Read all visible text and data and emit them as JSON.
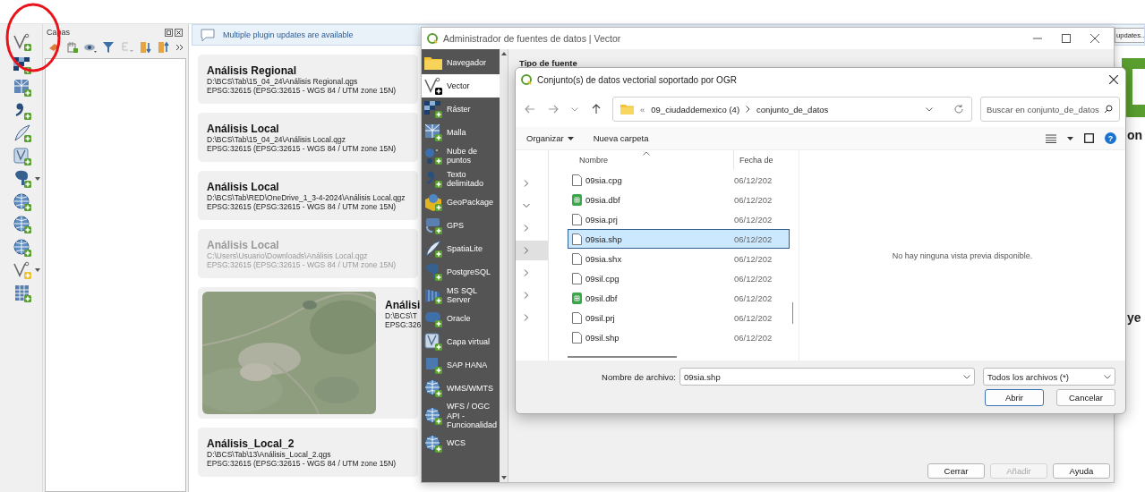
{
  "layers_panel": {
    "title": "Capas"
  },
  "message_bar": {
    "text": "Multiple plugin updates are available",
    "button": "updates..."
  },
  "recent_projects": [
    {
      "kind": "text",
      "title": "Análisis Regional",
      "path": "D:\\BCS\\Tab\\15_04_24\\Análisis Regional.qgs",
      "crs": "EPSG:32615 (EPSG:32615 - WGS 84 / UTM zone 15N)",
      "disabled": false
    },
    {
      "kind": "text",
      "title": "Análisis Local",
      "path": "D:\\BCS\\Tab\\15_04_24\\Análisis Local.qgz",
      "crs": "EPSG:32615 (EPSG:32615 - WGS 84 / UTM zone 15N)",
      "disabled": false
    },
    {
      "kind": "text",
      "title": "Análisis Local",
      "path": "D:\\BCS\\Tab\\RED\\OneDrive_1_3-4-2024\\Análisis Local.qgz",
      "crs": "EPSG:32615 (EPSG:32615 - WGS 84 / UTM zone 15N)",
      "disabled": false
    },
    {
      "kind": "text",
      "title": "Análisis Local",
      "path": "C:\\Users\\Usuario\\Downloads\\Análisis Local.qgz",
      "crs": "EPSG:32615 (EPSG:32615 - WGS 84 / UTM zone 15N)",
      "disabled": true
    },
    {
      "kind": "picture",
      "title": "Análisi",
      "path": "D:\\BCS\\T",
      "crs": "EPSG:326",
      "disabled": false
    },
    {
      "kind": "text",
      "title": "Análisis_Local_2",
      "path": "D:\\BCS\\Tab\\13\\Análisis_Local_2.qgs",
      "crs": "EPSG:32615 (EPSG:32615 - WGS 84 / UTM zone 15N)",
      "disabled": false
    }
  ],
  "right_column": {
    "heading_fragment": "on",
    "section_fragment": "ye"
  },
  "source_manager": {
    "title": "Administrador de fuentes de datos | Vector",
    "section_heading": "Tipo de fuente",
    "sidebar": [
      {
        "label": "Navegador",
        "selected": false
      },
      {
        "label": "Vector",
        "selected": true
      },
      {
        "label": "Ráster",
        "selected": false
      },
      {
        "label": "Malla",
        "selected": false
      },
      {
        "label": "Nube de puntos",
        "selected": false
      },
      {
        "label": "Texto delimitado",
        "selected": false
      },
      {
        "label": "GeoPackage",
        "selected": false
      },
      {
        "label": "GPS",
        "selected": false
      },
      {
        "label": "SpatiaLite",
        "selected": false
      },
      {
        "label": "PostgreSQL",
        "selected": false
      },
      {
        "label": "MS SQL Server",
        "selected": false
      },
      {
        "label": "Oracle",
        "selected": false
      },
      {
        "label": "Capa virtual",
        "selected": false
      },
      {
        "label": "SAP HANA",
        "selected": false
      },
      {
        "label": "WMS/WMTS",
        "selected": false
      },
      {
        "label": "WFS / OGC API - Funcionalidad",
        "selected": false
      },
      {
        "label": "WCS",
        "selected": false
      }
    ],
    "buttons": [
      {
        "label": "Cerrar",
        "disabled": false
      },
      {
        "label": "Añadir",
        "disabled": true
      },
      {
        "label": "Ayuda",
        "disabled": false
      }
    ]
  },
  "file_dialog": {
    "title": "Conjunto(s) de datos vectorial soportado por OGR",
    "overflow": "«",
    "breadcrumb": [
      "09_ciudaddemexico (4)",
      "conjunto_de_datos"
    ],
    "search": {
      "placeholder": "Buscar en conjunto_de_datos"
    },
    "toolbar": [
      {
        "label": "Organizar",
        "menu": true
      },
      {
        "label": "Nueva carpeta",
        "menu": false
      }
    ],
    "help": "?",
    "nav_tree": [
      {
        "expanded": false,
        "selected": false
      },
      {
        "expanded": true,
        "selected": false
      },
      {
        "expanded": false,
        "selected": false
      },
      {
        "expanded": false,
        "selected": true
      },
      {
        "expanded": false,
        "selected": false
      },
      {
        "expanded": false,
        "selected": false
      },
      {
        "expanded": false,
        "selected": false
      }
    ],
    "columns": [
      "Nombre",
      "Fecha de"
    ],
    "files": [
      {
        "name": "09sia.cpg",
        "date": "06/12/202",
        "kind": "document",
        "selected": false
      },
      {
        "name": "09sia.dbf",
        "date": "06/12/202",
        "kind": "sheet",
        "selected": false
      },
      {
        "name": "09sia.prj",
        "date": "06/12/202",
        "kind": "document",
        "selected": false
      },
      {
        "name": "09sia.shp",
        "date": "06/12/202",
        "kind": "document",
        "selected": true
      },
      {
        "name": "09sia.shx",
        "date": "06/12/202",
        "kind": "document",
        "selected": false
      },
      {
        "name": "09sil.cpg",
        "date": "06/12/202",
        "kind": "document",
        "selected": false
      },
      {
        "name": "09sil.dbf",
        "date": "06/12/202",
        "kind": "sheet",
        "selected": false
      },
      {
        "name": "09sil.prj",
        "date": "06/12/202",
        "kind": "document",
        "selected": false
      },
      {
        "name": "09sil.shp",
        "date": "06/12/202",
        "kind": "document",
        "selected": false
      }
    ],
    "preview_message": "No hay ninguna vista previa disponible.",
    "filename": {
      "label": "Nombre de archivo:",
      "value": "09sia.shp"
    },
    "filter": "Todos los archivos (*)",
    "buttons": [
      {
        "label": "Abrir",
        "default": true
      },
      {
        "label": "Cancelar",
        "default": false
      }
    ]
  }
}
